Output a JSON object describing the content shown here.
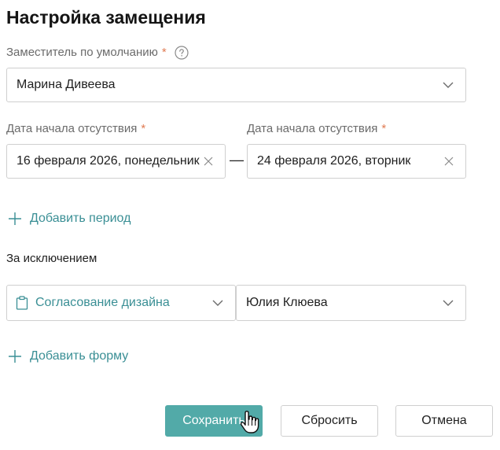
{
  "title": "Настройка замещения",
  "default_substitute": {
    "label": "Заместитель по умолчанию",
    "required_mark": "*",
    "value": "Марина Дивеева"
  },
  "period": {
    "start_label": "Дата начала отсутствия",
    "start_required_mark": "*",
    "start_value": "16 февраля 2026, понедельник",
    "separator": "—",
    "end_label": "Дата начала отсутствия",
    "end_required_mark": "*",
    "end_value": "24 февраля 2026, вторник"
  },
  "add_period_label": "Добавить период",
  "exceptions": {
    "label": "За исключением",
    "form_value": "Согласование дизайна",
    "person_value": "Юлия Клюева"
  },
  "add_form_label": "Добавить форму",
  "buttons": {
    "save": "Сохранить",
    "reset": "Сбросить",
    "cancel": "Отмена"
  },
  "colors": {
    "accent": "#52aaa8",
    "link": "#3a8f95",
    "required": "#e07b53"
  },
  "icons": {
    "help": "help-icon",
    "chevron": "chevron-down-icon",
    "clear": "close-icon",
    "add": "plus-icon",
    "form": "clipboard-icon",
    "cursor": "hand-cursor-icon"
  }
}
